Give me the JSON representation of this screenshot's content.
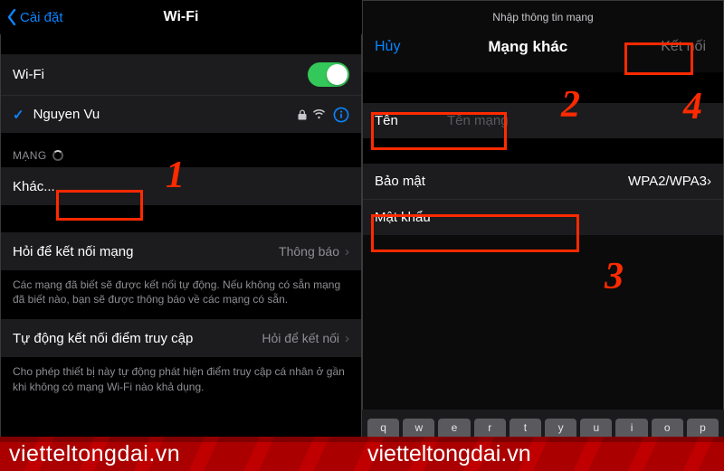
{
  "annotations": {
    "n1": "1",
    "n2": "2",
    "n3": "3",
    "n4": "4"
  },
  "watermark": {
    "text": "vietteltongdai.vn"
  },
  "left": {
    "back_label": "Cài đặt",
    "title": "Wi-Fi",
    "wifi_row_label": "Wi-Fi",
    "network_name": "Nguyen Vu",
    "networks_header": "MẠNG",
    "other_label": "Khác...",
    "ask_label": "Hỏi để kết nối mạng",
    "ask_value": "Thông báo",
    "ask_footer": "Các mạng đã biết sẽ được kết nối tự động. Nếu không có sẵn mạng đã biết nào, bạn sẽ được thông báo về các mạng có sẵn.",
    "hotspot_label": "Tự động kết nối điểm truy cập",
    "hotspot_value": "Hỏi để kết nối",
    "hotspot_footer": "Cho phép thiết bị này tự động phát hiện điểm truy cập cá nhân ở gần khi không có mạng Wi-Fi nào khả dụng."
  },
  "right": {
    "mini_title": "Nhập thông tin mạng",
    "cancel": "Hủy",
    "center_title": "Mạng khác",
    "connect": "Kết nối",
    "name_label": "Tên",
    "name_placeholder": "Tên mạng",
    "security_label": "Bảo mật",
    "security_value": "WPA2/WPA3",
    "password_label": "Mật khẩu",
    "keys": [
      "q",
      "w",
      "e",
      "r",
      "t",
      "y",
      "u",
      "i",
      "o",
      "p"
    ]
  }
}
